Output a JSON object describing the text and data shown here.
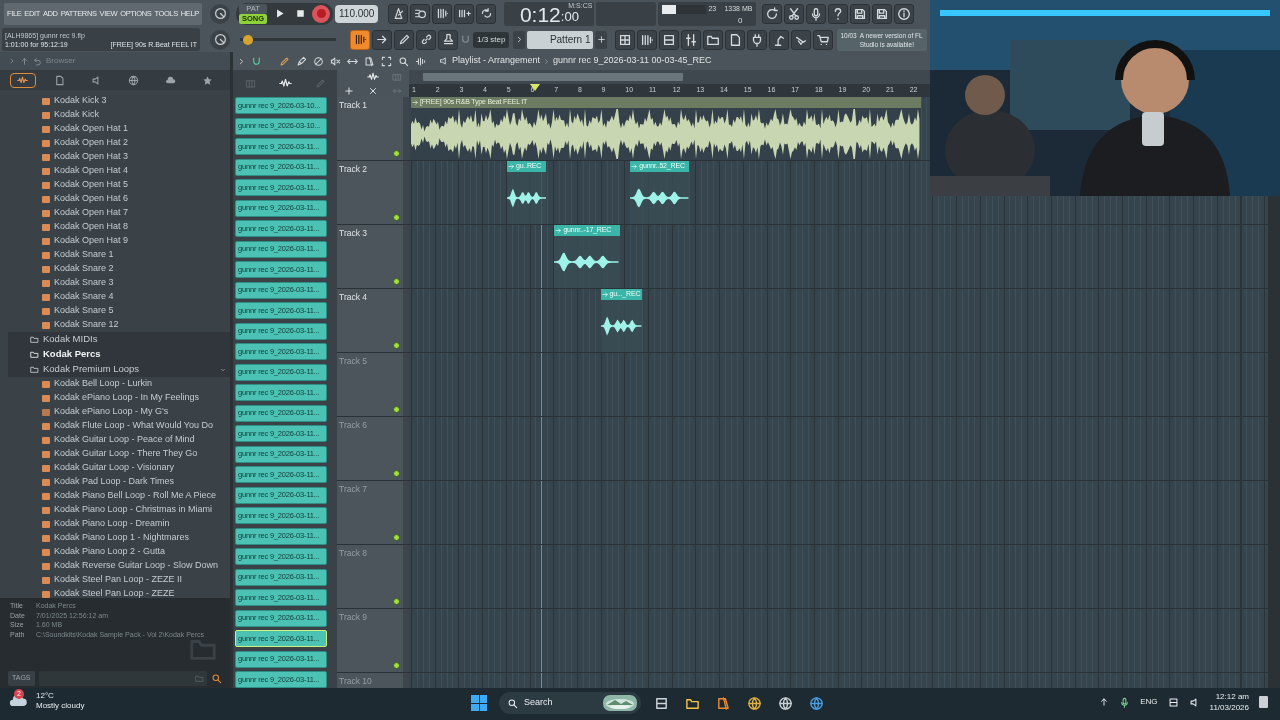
{
  "menu": [
    "FILE",
    "EDIT",
    "ADD",
    "PATTERNS",
    "VIEW",
    "OPTIONS",
    "TOOLS",
    "HELP"
  ],
  "transport": {
    "modes": [
      {
        "label": "PAT",
        "selected": false
      },
      {
        "label": "SONG",
        "selected": true
      }
    ],
    "tempo": "110.000"
  },
  "time": {
    "main": "0:12",
    "sub": ":00",
    "units": "M:S:CS"
  },
  "monitor": {
    "cpu": "23",
    "memory": "1338 MB",
    "polyphony": "0",
    "level": 0.3
  },
  "master": {
    "level": 0.08
  },
  "hint": {
    "project": "[ALH9865] gunnr rec 9.flp",
    "position": "1:01:00 for 95:12:19",
    "clip": "[FREE] 90s R.Beat FEEL IT"
  },
  "snap": "1/3 step",
  "pattern": "Pattern 1",
  "news": {
    "date": "10/03",
    "text": "A newer version of FL Studio is available!"
  },
  "browser": {
    "title": "Browser",
    "tabs": [
      {
        "selected": true
      },
      {
        "selected": false
      },
      {
        "selected": false
      },
      {
        "selected": false
      },
      {
        "selected": false
      },
      {
        "selected": false
      }
    ],
    "tree": [
      {
        "kind": "sample",
        "label": "Kodak Kick 3"
      },
      {
        "kind": "sample",
        "label": "Kodak Kick"
      },
      {
        "kind": "sample",
        "label": "Kodak Open Hat 1"
      },
      {
        "kind": "sample",
        "label": "Kodak Open Hat 2"
      },
      {
        "kind": "sample",
        "label": "Kodak Open Hat 3"
      },
      {
        "kind": "sample",
        "label": "Kodak Open Hat 4"
      },
      {
        "kind": "sample",
        "label": "Kodak Open Hat 5"
      },
      {
        "kind": "sample",
        "label": "Kodak Open Hat 6"
      },
      {
        "kind": "sample",
        "label": "Kodak Open Hat 7"
      },
      {
        "kind": "sample",
        "label": "Kodak Open Hat 8"
      },
      {
        "kind": "sample",
        "label": "Kodak Open Hat 9"
      },
      {
        "kind": "sample",
        "label": "Kodak Snare 1"
      },
      {
        "kind": "sample",
        "label": "Kodak Snare 2"
      },
      {
        "kind": "sample",
        "label": "Kodak Snare 3"
      },
      {
        "kind": "sample",
        "label": "Kodak Snare 4"
      },
      {
        "kind": "sample",
        "label": "Kodak Snare 5"
      },
      {
        "kind": "sample",
        "label": "Kodak Snare 12"
      },
      {
        "kind": "folder",
        "label": "Kodak MIDIs",
        "expanded": false,
        "selected": false
      },
      {
        "kind": "folder",
        "label": "Kodak Percs",
        "expanded": false,
        "selected": true
      },
      {
        "kind": "folder",
        "label": "Kodak Premium Loops",
        "expanded": true,
        "selected": false,
        "children": [
          {
            "kind": "sample",
            "label": "Kodak Bell Loop - Lurkin"
          },
          {
            "kind": "sample",
            "label": "Kodak ePiano Loop - In My Feelings"
          },
          {
            "kind": "mp3",
            "label": "Kodak ePiano Loop - My G's"
          },
          {
            "kind": "sample",
            "label": "Kodak Flute Loop - What Would You Do"
          },
          {
            "kind": "sample",
            "label": "Kodak Guitar Loop - Peace of Mind"
          },
          {
            "kind": "sample",
            "label": "Kodak Guitar Loop - There They Go"
          },
          {
            "kind": "sample",
            "label": "Kodak Guitar Loop - Visionary"
          },
          {
            "kind": "sample",
            "label": "Kodak Pad Loop - Dark Times"
          },
          {
            "kind": "sample",
            "label": "Kodak Piano Bell Loop - Roll Me A Piece"
          },
          {
            "kind": "sample",
            "label": "Kodak Piano Loop - Christmas in Miami"
          },
          {
            "kind": "sample",
            "label": "Kodak Piano Loop - Dreamin"
          },
          {
            "kind": "sample",
            "label": "Kodak Piano Loop 1 - Nightmares"
          },
          {
            "kind": "sample",
            "label": "Kodak Piano Loop 2 - Gutta"
          },
          {
            "kind": "sample",
            "label": "Kodak Reverse Guitar Loop - Slow Down"
          },
          {
            "kind": "sample",
            "label": "Kodak Steel Pan Loop - ZEZE II"
          },
          {
            "kind": "sample",
            "label": "Kodak Steel Pan Loop - ZEZE"
          }
        ]
      }
    ],
    "info": [
      {
        "label": "Title",
        "value": "Kodak Percs"
      },
      {
        "label": "Date",
        "value": "7/01/2025 12:56:12 am"
      },
      {
        "label": "Size",
        "value": "1.60 MB"
      },
      {
        "label": "Path",
        "value": "C:\\Soundkits\\Kodak Sample Pack - Vol 2\\Kodak Percs"
      }
    ],
    "tags": "TAGS"
  },
  "picker": [
    {
      "label": "gunnr rec 9_2026-03-10...",
      "selected": false
    },
    {
      "label": "gunnr rec 9_2026-03-10...",
      "selected": false
    },
    {
      "label": "gunnr rec 9_2026-03-11...",
      "selected": false
    },
    {
      "label": "gunnr rec 9_2026-03-11...",
      "selected": false
    },
    {
      "label": "gunnr rec 9_2026-03-11...",
      "selected": false
    },
    {
      "label": "gunnr rec 9_2026-03-11...",
      "selected": false
    },
    {
      "label": "gunnr rec 9_2026-03-11...",
      "selected": false
    },
    {
      "label": "gunnr rec 9_2026-03-11...",
      "selected": false
    },
    {
      "label": "gunnr rec 9_2026-03-11...",
      "selected": false
    },
    {
      "label": "gunnr rec 9_2026-03-11...",
      "selected": false
    },
    {
      "label": "gunnr rec 9_2026-03-11...",
      "selected": false
    },
    {
      "label": "gunnr rec 9_2026-03-11...",
      "selected": false
    },
    {
      "label": "gunnr rec 9_2026-03-11...",
      "selected": false
    },
    {
      "label": "gunnr rec 9_2026-03-11...",
      "selected": false
    },
    {
      "label": "gunnr rec 9_2026-03-11...",
      "selected": false
    },
    {
      "label": "gunnr rec 9_2026-03-11...",
      "selected": false
    },
    {
      "label": "gunnr rec 9_2026-03-11...",
      "selected": false
    },
    {
      "label": "gunnr rec 9_2026-03-11...",
      "selected": false
    },
    {
      "label": "gunnr rec 9_2026-03-11...",
      "selected": false
    },
    {
      "label": "gunnr rec 9_2026-03-11...",
      "selected": false
    },
    {
      "label": "gunnr rec 9_2026-03-11...",
      "selected": false
    },
    {
      "label": "gunnr rec 9_2026-03-11...",
      "selected": false
    },
    {
      "label": "gunnr rec 9_2026-03-11...",
      "selected": false
    },
    {
      "label": "gunnr rec 9_2026-03-11...",
      "selected": false
    },
    {
      "label": "gunnr rec 9_2026-03-11...",
      "selected": false
    },
    {
      "label": "gunnr rec 9_2026-03-11...",
      "selected": false
    },
    {
      "label": "gunnr rec 9_2026-03-11...",
      "selected": true
    },
    {
      "label": "gunnr rec 9_2026-03-11...",
      "selected": false
    },
    {
      "label": "gunnr rec 9_2026-03-11...",
      "selected": false
    }
  ],
  "playlist": {
    "title": "Playlist - Arrangement",
    "song": "gunnr rec 9_2026-03-11 00-03-45_REC",
    "ruler": [
      "1",
      "2",
      "3",
      "4",
      "5",
      "6",
      "7",
      "8",
      "9",
      "10",
      "11",
      "12",
      "13",
      "14",
      "15",
      "16",
      "17",
      "18",
      "19",
      "20",
      "21",
      "22"
    ],
    "tracks": [
      {
        "name": "Track 1",
        "clips": [
          {
            "kind": "beat",
            "label": "[FREE] 90s R&B Type Beat FEEL IT"
          }
        ]
      },
      {
        "name": "Track 2",
        "clips": [
          {
            "kind": "vocal",
            "label": "gu..REC"
          },
          {
            "kind": "vocal",
            "label": "gunnr..52_REC"
          }
        ]
      },
      {
        "name": "Track 3",
        "clips": [
          {
            "kind": "vocal",
            "label": "gunnr..-17_REC"
          }
        ]
      },
      {
        "name": "Track 4",
        "clips": [
          {
            "kind": "vocal",
            "label": "gu..._REC"
          }
        ]
      },
      {
        "name": "Track 5"
      },
      {
        "name": "Track 6"
      },
      {
        "name": "Track 7"
      },
      {
        "name": "Track 8"
      },
      {
        "name": "Track 9"
      },
      {
        "name": "Track 10"
      }
    ]
  },
  "taskbar": {
    "weather": {
      "badge": "2",
      "temp": "12°C",
      "text": "Mostly cloudy"
    },
    "search": "Search",
    "tray": {
      "lang": "ENG",
      "time": "12:12 am",
      "date": "11/03/2026"
    }
  }
}
